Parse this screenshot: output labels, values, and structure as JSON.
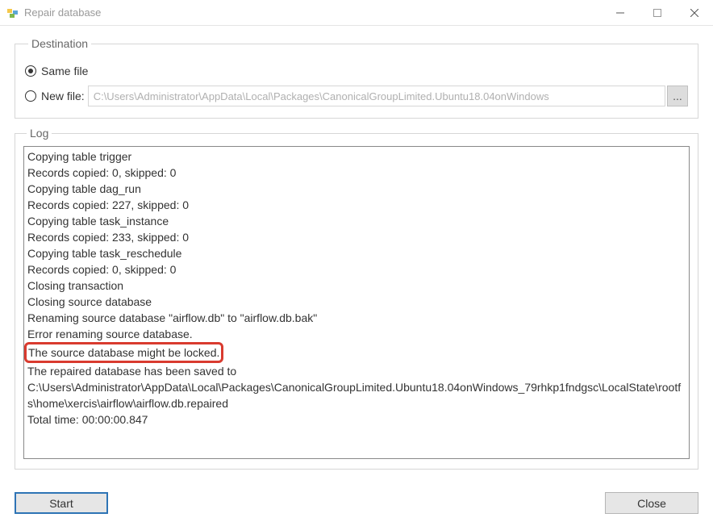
{
  "window": {
    "title": "Repair database"
  },
  "destination": {
    "legend": "Destination",
    "same_file_label": "Same file",
    "new_file_label": "New file:",
    "selected": "same_file",
    "new_file_path": "C:\\Users\\Administrator\\AppData\\Local\\Packages\\CanonicalGroupLimited.Ubuntu18.04onWindows",
    "browse_label": "..."
  },
  "log": {
    "legend": "Log",
    "lines": [
      "Copying table trigger",
      "Records copied: 0, skipped: 0",
      "Copying table dag_run",
      "Records copied: 227, skipped: 0",
      "Copying table task_instance",
      "Records copied: 233, skipped: 0",
      "Copying table task_reschedule",
      "Records copied: 0, skipped: 0",
      "Closing transaction",
      "Closing source database",
      "Renaming source database \"airflow.db\" to \"airflow.db.bak\"",
      "Error renaming source database."
    ],
    "highlight_line": "The source database might be locked.",
    "after_lines": [
      "The repaired database has been saved to C:\\Users\\Administrator\\AppData\\Local\\Packages\\CanonicalGroupLimited.Ubuntu18.04onWindows_79rhkp1fndgsc\\LocalState\\rootfs\\home\\xercis\\airflow\\airflow.db.repaired",
      "Total time: 00:00:00.847"
    ]
  },
  "buttons": {
    "start": "Start",
    "close": "Close"
  }
}
